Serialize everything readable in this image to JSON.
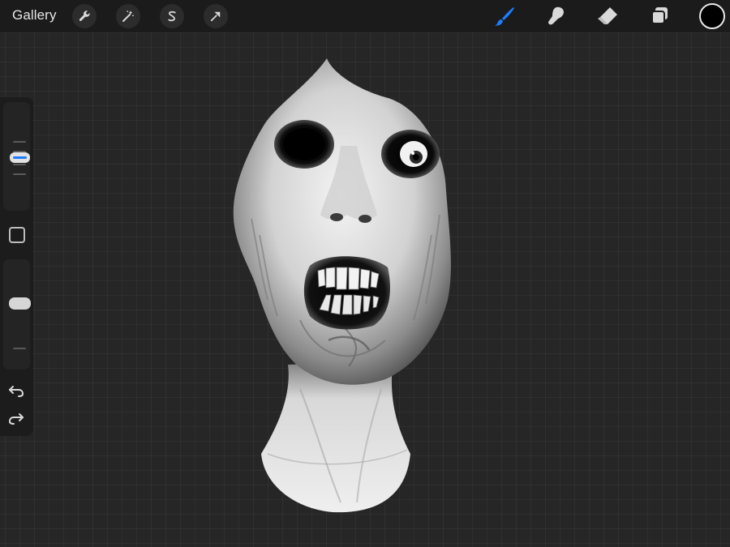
{
  "header": {
    "gallery_label": "Gallery",
    "left_tools": [
      {
        "name": "actions",
        "icon": "wrench-icon"
      },
      {
        "name": "adjustments",
        "icon": "magic-wand-icon"
      },
      {
        "name": "selection",
        "icon": "selection-s-icon"
      },
      {
        "name": "transform",
        "icon": "arrow-cursor-icon"
      }
    ],
    "right_tools": [
      {
        "name": "brush",
        "icon": "brush-icon",
        "active": true
      },
      {
        "name": "smudge",
        "icon": "smudge-finger-icon",
        "active": false
      },
      {
        "name": "eraser",
        "icon": "eraser-icon",
        "active": false
      },
      {
        "name": "layers",
        "icon": "layers-icon",
        "active": false
      }
    ],
    "current_color": "#000000"
  },
  "sidebar": {
    "brush_size_icon": "size-slider",
    "modify_icon": "square-modifier-icon",
    "opacity_icon": "opacity-slider",
    "undo_icon": "undo-icon",
    "redo_icon": "redo-icon"
  },
  "colors": {
    "accent": "#1e7bff",
    "topbar": "#1b1b1b",
    "canvas": "#262626"
  }
}
